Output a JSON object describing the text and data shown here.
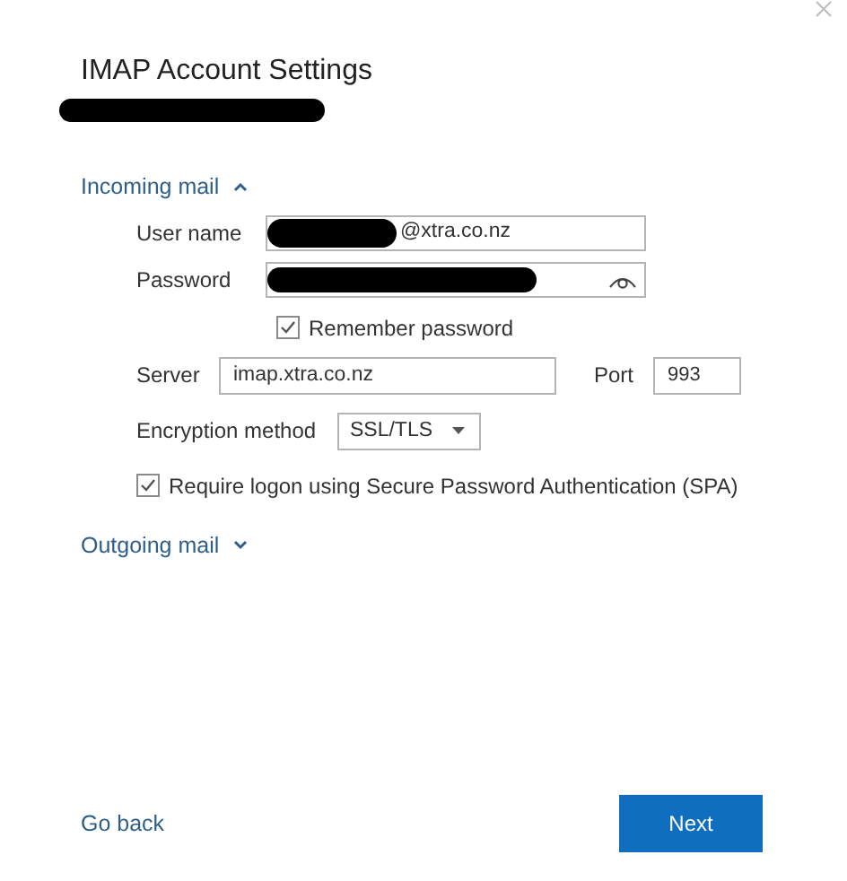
{
  "window": {
    "title": "IMAP Account Settings"
  },
  "incoming": {
    "label": "Incoming mail",
    "expanded": true
  },
  "user_name": {
    "label": "User name",
    "value": "@xtra.co.nz"
  },
  "password": {
    "label": "Password"
  },
  "remember": {
    "label": "Remember password",
    "checked": true
  },
  "server": {
    "label": "Server",
    "value": "imap.xtra.co.nz"
  },
  "port": {
    "label": "Port",
    "value": "993"
  },
  "encryption": {
    "label": "Encryption method",
    "value": "SSL/TLS"
  },
  "spa": {
    "label": "Require logon using Secure Password Authentication (SPA)",
    "checked": true
  },
  "outgoing": {
    "label": "Outgoing mail",
    "expanded": false
  },
  "buttons": {
    "back": "Go back",
    "next": "Next"
  }
}
